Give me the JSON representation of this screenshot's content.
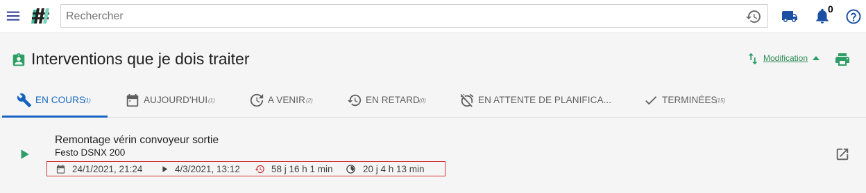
{
  "topbar": {
    "search_placeholder": "Rechercher",
    "notification_count": "0",
    "icons": [
      "menu-icon",
      "app-logo",
      "history-icon",
      "truck-icon",
      "bell-icon",
      "help-icon"
    ]
  },
  "header": {
    "title": "Interventions que je dois traiter",
    "sort_label": "Modification",
    "icons": [
      "assignment-icon",
      "sort-icon",
      "print-icon"
    ]
  },
  "tabs": [
    {
      "label": "EN COURS",
      "count": "(1)",
      "icon": "wrench-icon",
      "active": true
    },
    {
      "label": "AUJOURD'HUI",
      "count": "(1)",
      "icon": "calendar-icon",
      "active": false
    },
    {
      "label": "A VENIR",
      "count": "(2)",
      "icon": "upcoming-icon",
      "active": false
    },
    {
      "label": "EN RETARD",
      "count": "(0)",
      "icon": "history-icon",
      "active": false
    },
    {
      "label": "EN ATTENTE DE PLANIFICA...",
      "count": "",
      "icon": "alarm-off-icon",
      "active": false
    },
    {
      "label": "TERMINÉES",
      "count": "(15)",
      "icon": "check-icon",
      "active": false
    }
  ],
  "item": {
    "title": "Remontage vérin convoyeur sortie",
    "subtitle": "Festo DSNX 200",
    "created": "24/1/2021, 21:24",
    "started": "4/3/2021, 13:12",
    "overdue": "58 j  16 h  1 min",
    "elapsed": "20 j  4 h  13 min"
  },
  "colors": {
    "accent": "#1565c0",
    "green": "#2e9e66",
    "overdue_red": "#d32f2f",
    "background": "#f5f5f5"
  }
}
